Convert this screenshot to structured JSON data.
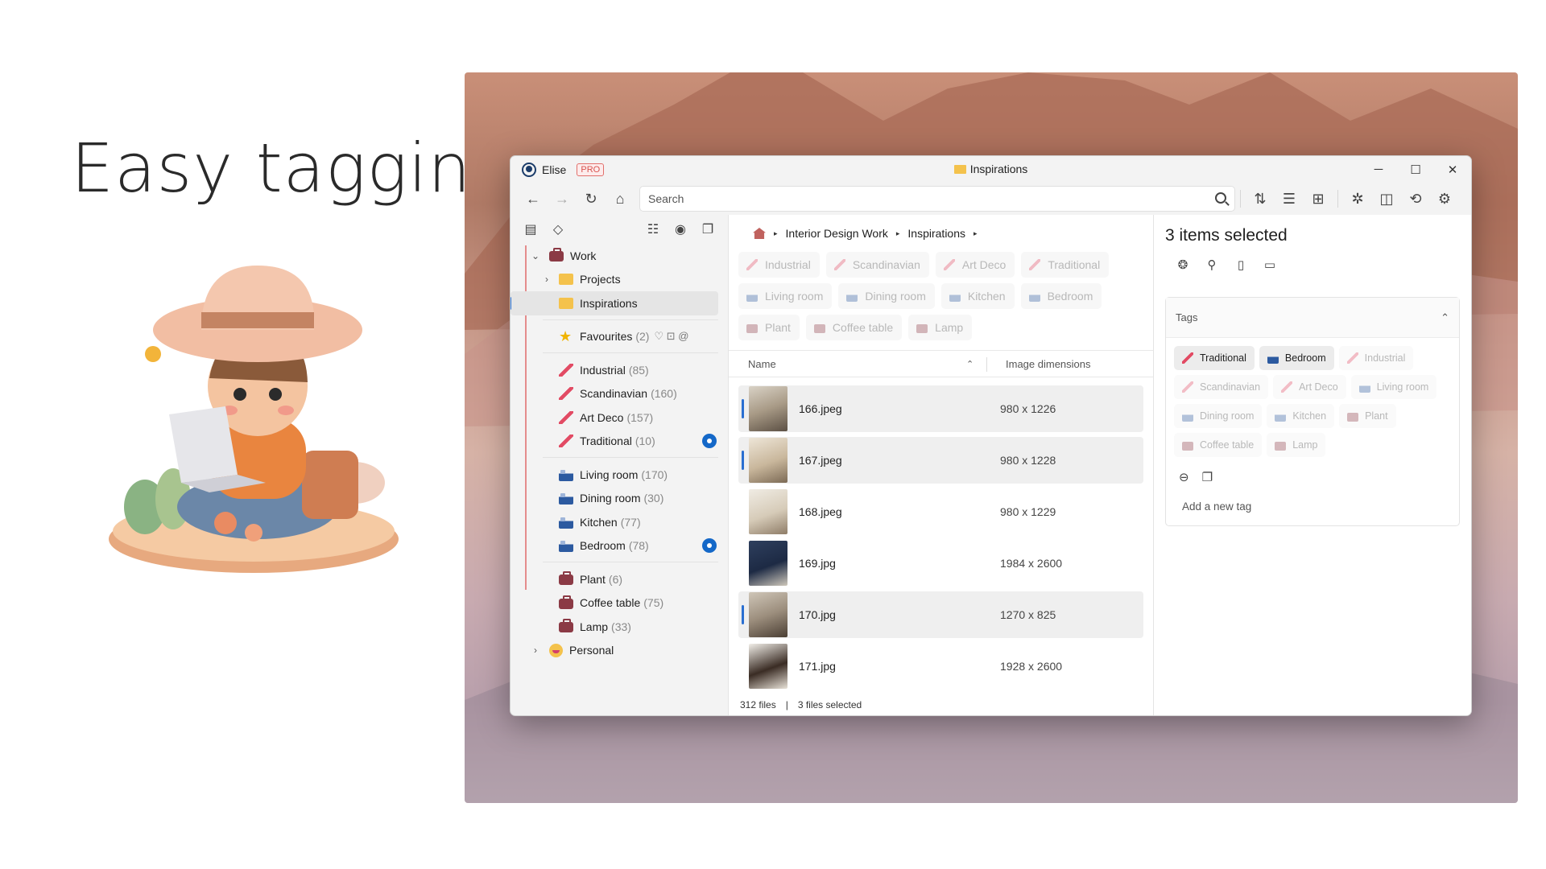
{
  "headline": "Easy tagging",
  "window": {
    "user": "Elise",
    "badge": "PRO",
    "title": "Inspirations",
    "controls": {
      "minimize": "─",
      "maximize": "☐",
      "close": "✕"
    }
  },
  "toolbar": {
    "search_placeholder": "Search"
  },
  "sidebar": {
    "work": "Work",
    "projects": "Projects",
    "inspirations": "Inspirations",
    "favourites": {
      "label": "Favourites",
      "count": "(2)"
    },
    "style_tags": [
      {
        "label": "Industrial",
        "count": "(85)"
      },
      {
        "label": "Scandinavian",
        "count": "(160)"
      },
      {
        "label": "Art Deco",
        "count": "(157)"
      },
      {
        "label": "Traditional",
        "count": "(10)"
      }
    ],
    "room_tags": [
      {
        "label": "Living room",
        "count": "(170)"
      },
      {
        "label": "Dining room",
        "count": "(30)"
      },
      {
        "label": "Kitchen",
        "count": "(77)"
      },
      {
        "label": "Bedroom",
        "count": "(78)"
      }
    ],
    "object_tags": [
      {
        "label": "Plant",
        "count": "(6)"
      },
      {
        "label": "Coffee table",
        "count": "(75)"
      },
      {
        "label": "Lamp",
        "count": "(33)"
      }
    ],
    "personal": "Personal"
  },
  "breadcrumb": [
    "Interior Design Work",
    "Inspirations"
  ],
  "filter_chips": {
    "row1": [
      "Industrial",
      "Scandinavian",
      "Art Deco",
      "Traditional"
    ],
    "row2": [
      "Living room",
      "Dining room",
      "Kitchen",
      "Bedroom"
    ],
    "row3": [
      "Plant",
      "Coffee table",
      "Lamp"
    ]
  },
  "columns": {
    "name": "Name",
    "dims": "Image dimensions"
  },
  "files": [
    {
      "name": "166.jpeg",
      "dims": "980 x 1226",
      "selected": true
    },
    {
      "name": "167.jpeg",
      "dims": "980 x 1228",
      "selected": true
    },
    {
      "name": "168.jpeg",
      "dims": "980 x 1229",
      "selected": false
    },
    {
      "name": "169.jpg",
      "dims": "1984 x 2600",
      "selected": false
    },
    {
      "name": "170.jpg",
      "dims": "1270 x 825",
      "selected": true
    },
    {
      "name": "171.jpg",
      "dims": "1928 x 2600",
      "selected": false
    }
  ],
  "status": {
    "files": "312 files",
    "sep": "|",
    "selected": "3 files selected"
  },
  "details": {
    "title": "3 items selected",
    "tags_header": "Tags",
    "active_tags": [
      "Traditional",
      "Bedroom"
    ],
    "inactive_tags_row1": [
      "Industrial"
    ],
    "inactive_tags_row2": [
      "Scandinavian",
      "Art Deco"
    ],
    "inactive_tags_row3": [
      "Living room",
      "Dining room",
      "Kitchen"
    ],
    "inactive_tags_row4": [
      "Plant",
      "Coffee table",
      "Lamp"
    ],
    "add_tag": "Add a new tag"
  }
}
